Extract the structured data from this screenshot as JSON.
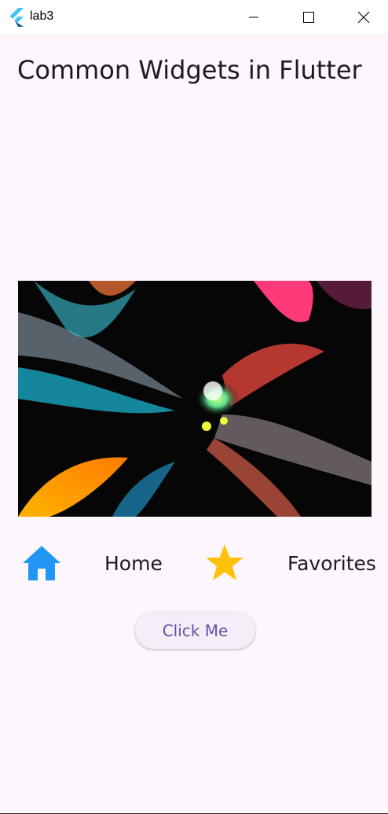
{
  "window": {
    "title": "lab3",
    "controls": [
      "minimize-icon",
      "maximize-icon",
      "close-icon"
    ]
  },
  "page": {
    "heading": "Common Widgets in Flutter",
    "image": {
      "description_icon": "abstract-image"
    },
    "row": {
      "home_icon": "home-icon",
      "home_label": "Home",
      "favorites_icon": "star-icon",
      "favorites_label": "Favorites"
    },
    "button_label": "Click Me"
  },
  "colors": {
    "background": "#fdf6fd",
    "home_icon": "#2196f3",
    "star_icon": "#ffc107",
    "button_text": "#6750a4",
    "button_bg": "#f4eef8"
  }
}
